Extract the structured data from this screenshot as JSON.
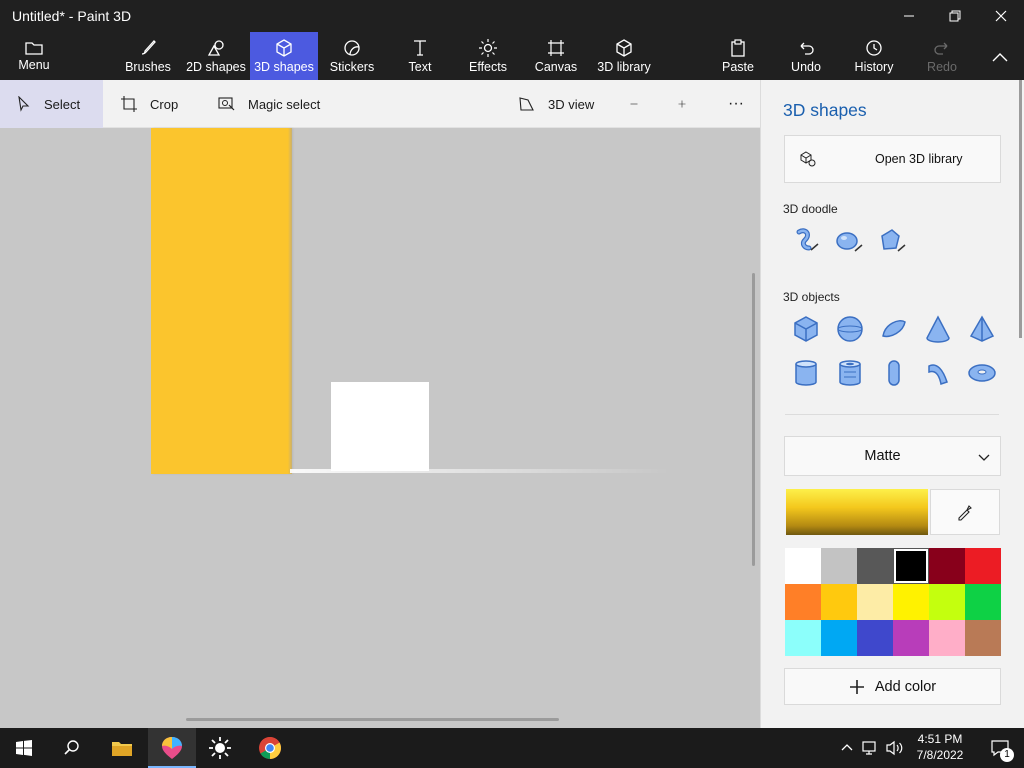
{
  "window": {
    "title": "Untitled* - Paint 3D"
  },
  "ribbon": {
    "menu": "Menu",
    "brushes": "Brushes",
    "shapes2d": "2D shapes",
    "shapes3d": "3D shapes",
    "stickers": "Stickers",
    "text": "Text",
    "effects": "Effects",
    "canvas": "Canvas",
    "library3d": "3D library",
    "paste": "Paste",
    "undo": "Undo",
    "history": "History",
    "redo": "Redo"
  },
  "toolbar": {
    "select": "Select",
    "crop": "Crop",
    "magic_select": "Magic select",
    "view3d": "3D view",
    "zoom_out": "—",
    "zoom_in": "+",
    "more": "···"
  },
  "panel": {
    "title": "3D shapes",
    "open_library": "Open 3D library",
    "doodle_section": "3D doodle",
    "objects_section": "3D objects",
    "material": "Matte",
    "add_color": "Add color",
    "palette": [
      "#ffffff",
      "#c3c3c3",
      "#585858",
      "#000000",
      "#88001b",
      "#ec1c24",
      "#ff7f27",
      "#ffc90e",
      "#fdeca6",
      "#fff200",
      "#c4ff0e",
      "#0ed145",
      "#8cfffb",
      "#00a8f3",
      "#3f48cc",
      "#b83dba",
      "#ffaec8",
      "#b97a56"
    ],
    "selected_color": "#000000"
  },
  "taskbar": {
    "time": "4:51 PM",
    "date": "7/8/2022",
    "notifications": "1"
  }
}
